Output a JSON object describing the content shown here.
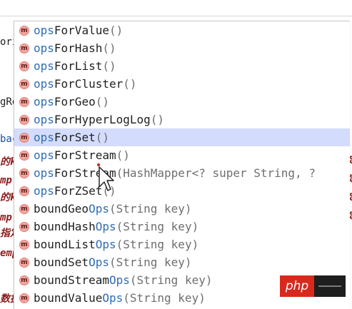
{
  "background_editor": {
    "left_fragments": [
      {
        "text": "ori",
        "kind": "code"
      },
      {
        "text": "gRe",
        "kind": "code"
      },
      {
        "text": "bac",
        "kind": "pkg"
      },
      {
        "text": "的k",
        "kind": "doc"
      },
      {
        "text": "mp",
        "kind": "doc"
      },
      {
        "text": "的k",
        "kind": "doc"
      },
      {
        "text": "mp",
        "kind": "doc"
      },
      {
        "text": "指定",
        "kind": "doc"
      },
      {
        "text": "emp",
        "kind": "doc"
      },
      {
        "text": "数据",
        "kind": "doc"
      }
    ],
    "right_fragments": [
      "定",
      "定",
      "定",
      "定"
    ]
  },
  "completion_popup": {
    "items": [
      {
        "icon": "m",
        "hl": "ops",
        "rest": "ForValue",
        "args": "()"
      },
      {
        "icon": "m",
        "hl": "ops",
        "rest": "ForHash",
        "args": "()"
      },
      {
        "icon": "m",
        "hl": "ops",
        "rest": "ForList",
        "args": "()"
      },
      {
        "icon": "m",
        "hl": "ops",
        "rest": "ForCluster",
        "args": "()"
      },
      {
        "icon": "m",
        "hl": "ops",
        "rest": "ForGeo",
        "args": "()"
      },
      {
        "icon": "m",
        "hl": "ops",
        "rest": "ForHyperLogLog",
        "args": "()"
      },
      {
        "icon": "m",
        "hl": "ops",
        "rest": "ForSet",
        "args": "()"
      },
      {
        "icon": "m",
        "hl": "ops",
        "rest": "ForStream",
        "args": "()"
      },
      {
        "icon": "m",
        "hl": "ops",
        "rest": "ForStream",
        "args": "(HashMapper<? super String, ?"
      },
      {
        "icon": "m",
        "hl": "ops",
        "rest": "ForZSet",
        "args": "()"
      },
      {
        "icon": "m",
        "pre": "boundGeo",
        "hl": "Ops",
        "args": "(String key)"
      },
      {
        "icon": "m",
        "pre": "boundHash",
        "hl": "Ops",
        "args": "(String key)"
      },
      {
        "icon": "m",
        "pre": "boundList",
        "hl": "Ops",
        "args": "(String key)"
      },
      {
        "icon": "m",
        "pre": "boundSet",
        "hl": "Ops",
        "args": "(String key)"
      },
      {
        "icon": "m",
        "pre": "boundStream",
        "hl": "Ops",
        "args": "(String key)"
      },
      {
        "icon": "m",
        "pre": "boundValue",
        "hl": "Ops",
        "args": "(String key)"
      }
    ],
    "selected_index": 6
  },
  "colors": {
    "match_highlight": "#2f6db5",
    "selection": "#d3dcfc",
    "method_icon": "#f0a7a0"
  },
  "watermark": {
    "text": "php"
  }
}
